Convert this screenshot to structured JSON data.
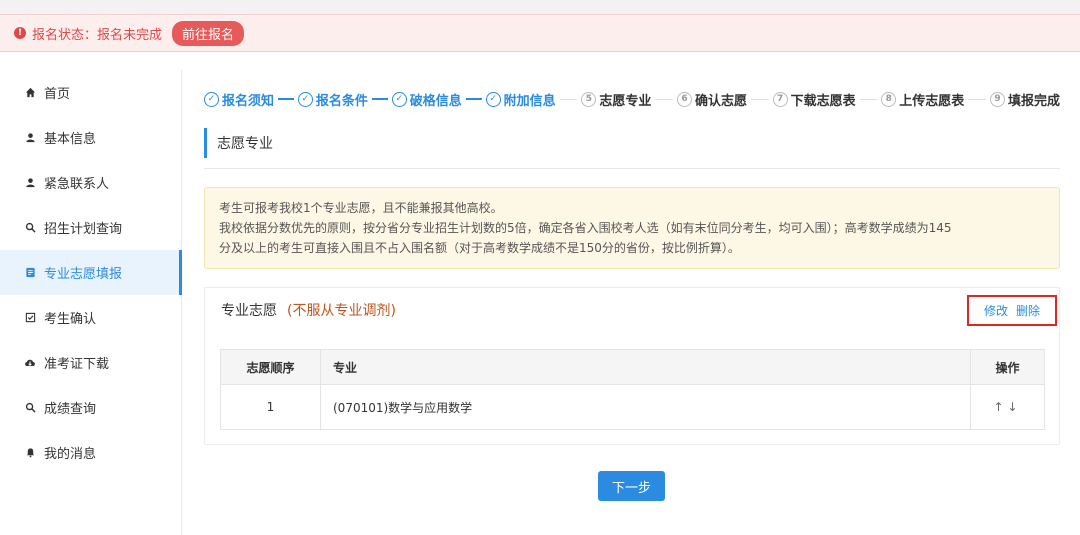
{
  "status": {
    "text": "报名状态：报名未完成",
    "button": "前往报名",
    "color": "#e04848"
  },
  "sidebar": {
    "items": [
      {
        "label": "首页",
        "icon": "home-icon"
      },
      {
        "label": "基本信息",
        "icon": "user-icon"
      },
      {
        "label": "紧急联系人",
        "icon": "user-icon"
      },
      {
        "label": "招生计划查询",
        "icon": "search-icon"
      },
      {
        "label": "专业志愿填报",
        "icon": "document-icon",
        "active": true
      },
      {
        "label": "考生确认",
        "icon": "checkbox-icon"
      },
      {
        "label": "准考证下载",
        "icon": "cloud-download-icon"
      },
      {
        "label": "成绩查询",
        "icon": "search-icon"
      },
      {
        "label": "我的消息",
        "icon": "bell-icon"
      }
    ]
  },
  "steps": [
    {
      "num": "✓",
      "label": "报名须知",
      "done": true
    },
    {
      "num": "✓",
      "label": "报名条件",
      "done": true
    },
    {
      "num": "✓",
      "label": "破格信息",
      "done": true
    },
    {
      "num": "✓",
      "label": "附加信息",
      "done": true
    },
    {
      "num": "5",
      "label": "志愿专业",
      "done": false
    },
    {
      "num": "6",
      "label": "确认志愿",
      "done": false
    },
    {
      "num": "7",
      "label": "下载志愿表",
      "done": false
    },
    {
      "num": "8",
      "label": "上传志愿表",
      "done": false
    },
    {
      "num": "9",
      "label": "填报完成",
      "done": false
    }
  ],
  "section": {
    "title": "志愿专业"
  },
  "notice": {
    "line1": "考生可报考我校1个专业志愿，且不能兼报其他高校。",
    "line2": "我校依据分数优先的原则，按分省分专业招生计划数的5倍，确定各省入围校考人选（如有末位同分考生，均可入围）；高考数学成绩为145",
    "line3": "分及以上的考生可直接入围且不占入围名额（对于高考数学成绩不是150分的省份，按比例折算）。"
  },
  "panel": {
    "title": "专业志愿",
    "note": "(不服从专业调剂)",
    "edit": "修改",
    "delete": "删除"
  },
  "table": {
    "headers": [
      "志愿顺序",
      "专业",
      "操作"
    ],
    "rows": [
      {
        "order": "1",
        "major": "(070101)数学与应用数学",
        "ops": "↑↓"
      }
    ]
  },
  "next": "下一步",
  "accent": "#2a8be0"
}
